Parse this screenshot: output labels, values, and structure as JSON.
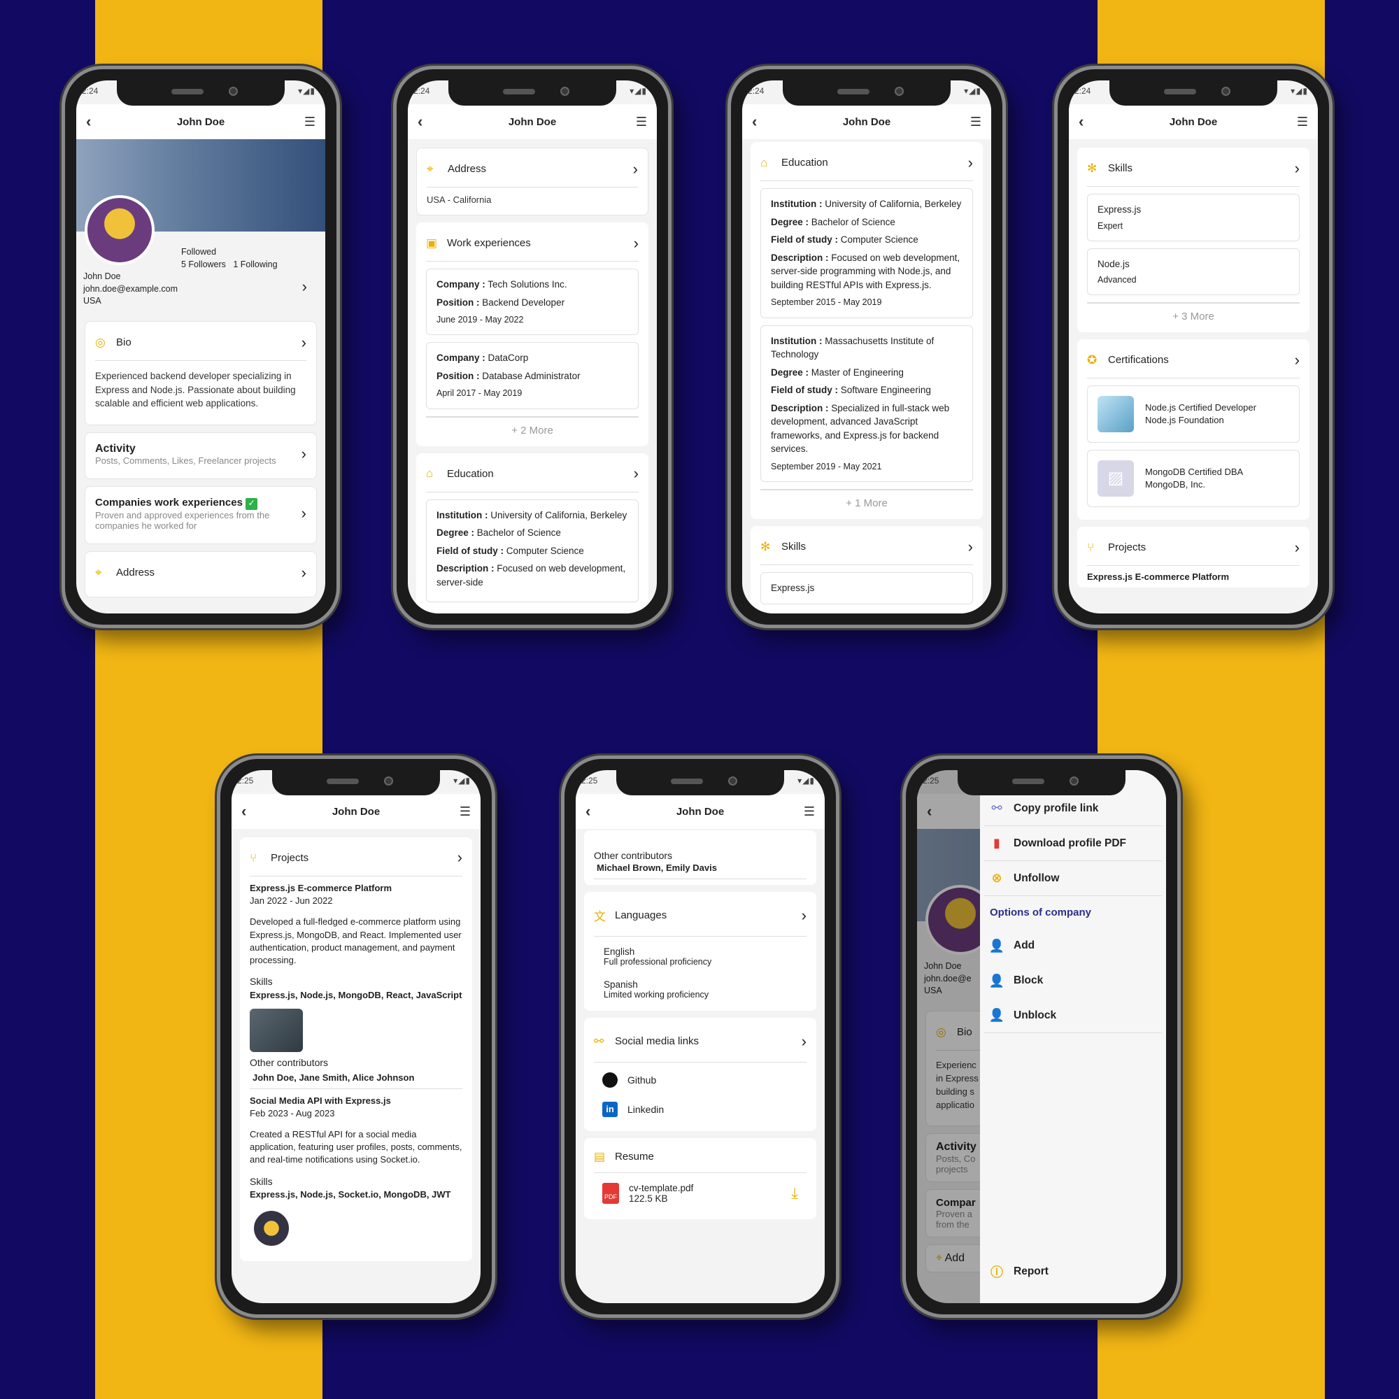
{
  "name": "John Doe",
  "status_time_1": "2:24",
  "status_time_2": "2:25",
  "p1": {
    "followed": "Followed",
    "followers": "5 Followers",
    "following": "1 Following",
    "name": "John Doe",
    "email": "john.doe@example.com",
    "country": "USA",
    "bio_title": "Bio",
    "bio_text": "Experienced backend developer specializing in Express and Node.js. Passionate about building scalable and efficient web applications.",
    "activity_title": "Activity",
    "activity_sub": "Posts, Comments, Likes, Freelancer projects",
    "cwe_title": "Companies work experiences",
    "cwe_sub": "Proven and approved experiences from the companies he worked for",
    "address_title": "Address"
  },
  "p2": {
    "address_title": "Address",
    "address_value": "USA - California",
    "work_title": "Work experiences",
    "jobs": [
      {
        "company_k": "Company :",
        "company": " Tech Solutions Inc.",
        "position_k": "Position :",
        "position": " Backend Developer",
        "dates": "June 2019 - May 2022"
      },
      {
        "company_k": "Company :",
        "company": " DataCorp",
        "position_k": "Position :",
        "position": " Database Administrator",
        "dates": "April 2017 - May 2019"
      }
    ],
    "work_more": "+ 2 More",
    "edu_title": "Education",
    "edu": {
      "inst_k": "Institution :",
      "inst": " University of California, Berkeley",
      "deg_k": "Degree :",
      "deg": " Bachelor of Science",
      "fos_k": "Field of study :",
      "fos": " Computer Science",
      "desc_k": "Description :",
      "desc": " Focused on web development, server-side"
    }
  },
  "p3": {
    "edu_title": "Education",
    "edus": [
      {
        "inst_k": "Institution :",
        "inst": " University of California, Berkeley",
        "deg_k": "Degree :",
        "deg": " Bachelor of Science",
        "fos_k": "Field of study :",
        "fos": " Computer Science",
        "desc_k": "Description :",
        "desc": " Focused on web development, server-side programming with Node.js, and building RESTful APIs with Express.js.",
        "dates": "September 2015 - May 2019"
      },
      {
        "inst_k": "Institution :",
        "inst": " Massachusetts Institute of Technology",
        "deg_k": "Degree :",
        "deg": " Master of Engineering",
        "fos_k": "Field of study :",
        "fos": " Software Engineering",
        "desc_k": "Description :",
        "desc": " Specialized in full-stack web development, advanced JavaScript frameworks, and Express.js for backend services.",
        "dates": "September 2019 - May 2021"
      }
    ],
    "edu_more": "+ 1 More",
    "skills_title": "Skills",
    "skills_peek": "Express.js"
  },
  "p4": {
    "skills_title": "Skills",
    "skills": [
      {
        "name": "Express.js",
        "level": "Expert"
      },
      {
        "name": "Node.js",
        "level": "Advanced"
      }
    ],
    "skills_more": "+ 3 More",
    "cert_title": "Certifications",
    "certs": [
      {
        "name": "Node.js Certified Developer",
        "org": "Node.js Foundation"
      },
      {
        "name": "MongoDB Certified DBA",
        "org": "MongoDB, Inc."
      }
    ],
    "projects_title": "Projects",
    "projects_peek": "Express.js E-commerce Platform"
  },
  "p5": {
    "projects_title": "Projects",
    "proj1": {
      "title": "Express.js E-commerce Platform",
      "dates": "Jan 2022 - Jun 2022",
      "desc": "Developed a full-fledged e-commerce platform using Express.js, MongoDB, and React. Implemented user authentication, product management, and payment processing.",
      "skills_label": "Skills",
      "skills": "Express.js, Node.js, MongoDB, React, JavaScript",
      "contrib_label": "Other contributors",
      "contrib": "John Doe, Jane Smith, Alice Johnson"
    },
    "proj2": {
      "title": "Social Media API with Express.js",
      "dates": "Feb 2023 - Aug 2023",
      "desc": "Created a RESTful API for a social media application, featuring user profiles, posts, comments, and real-time notifications using Socket.io.",
      "skills_label": "Skills",
      "skills": "Express.js, Node.js, Socket.io, MongoDB, JWT"
    }
  },
  "p6": {
    "contrib_label": "Other contributors",
    "contrib": "Michael Brown, Emily Davis",
    "lang_title": "Languages",
    "langs": [
      {
        "name": "English",
        "level": "Full professional proficiency"
      },
      {
        "name": "Spanish",
        "level": "Limited working proficiency"
      }
    ],
    "social_title": "Social media links",
    "social": [
      "Github",
      "Linkedin"
    ],
    "resume_title": "Resume",
    "file_name": "cv-template.pdf",
    "file_size": "122.5 KB"
  },
  "p7": {
    "menu": [
      "Copy profile link",
      "Download profile PDF",
      "Unfollow"
    ],
    "group": "Options of company",
    "company_menu": [
      "Add",
      "Block",
      "Unblock"
    ],
    "report": "Report",
    "bg_name": "John Doe",
    "bg_email": "john.doe@e",
    "bg_country": "USA",
    "bg_bio": "Bio",
    "bg_bio_text": [
      "Experienc",
      "in Express",
      "building s",
      "applicatio"
    ],
    "bg_activity": "Activity",
    "bg_activity_sub": [
      "Posts, Co",
      "projects"
    ],
    "bg_company": "Compar",
    "bg_company_sub": [
      "Proven a",
      "from the"
    ],
    "bg_address": "Add"
  },
  "colors": {
    "background": "#120a62",
    "stripe": "#f1b514",
    "accent": "#e8b100",
    "group": "#2c2e8a",
    "check": "#2eb04a",
    "pdf": "#e53935"
  }
}
